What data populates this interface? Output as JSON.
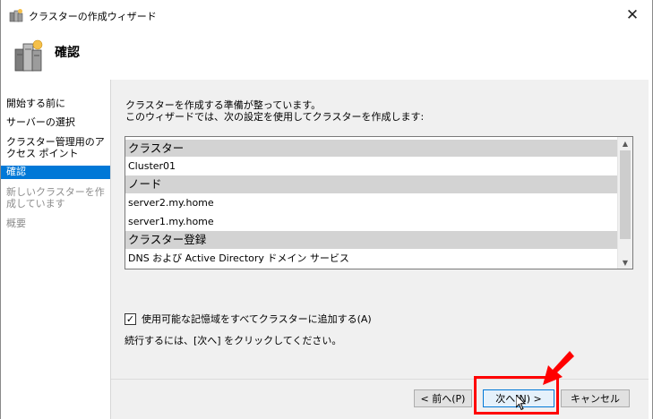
{
  "window": {
    "title": "クラスターの作成ウィザード",
    "close_glyph": "✕"
  },
  "header": {
    "title": "確認"
  },
  "nav": {
    "items": [
      {
        "label": "開始する前に",
        "state": "normal"
      },
      {
        "label": "サーバーの選択",
        "state": "normal"
      },
      {
        "label": "クラスター管理用のアクセス ポイント",
        "state": "normal"
      },
      {
        "label": "確認",
        "state": "active"
      },
      {
        "label": "新しいクラスターを作成しています",
        "state": "disabled"
      },
      {
        "label": "概要",
        "state": "disabled"
      }
    ]
  },
  "main": {
    "intro_line1": "クラスターを作成する準備が整っています。",
    "intro_line2": "このウィザードでは、次の設定を使用してクラスターを作成します:",
    "settings_list": [
      {
        "kind": "header",
        "text": "クラスター"
      },
      {
        "kind": "value",
        "text": "Cluster01"
      },
      {
        "kind": "header",
        "text": "ノード"
      },
      {
        "kind": "value",
        "text": "server2.my.home"
      },
      {
        "kind": "value",
        "text": "server1.my.home"
      },
      {
        "kind": "header",
        "text": "クラスター登録"
      },
      {
        "kind": "value",
        "text": "DNS および Active Directory ドメイン サービス"
      }
    ],
    "scroll_up_glyph": "▲",
    "scroll_down_glyph": "▼",
    "add_storage_label": "使用可能な記憶域をすべてクラスターに追加する(A)",
    "add_storage_checked": true,
    "check_glyph": "✓",
    "continue_note": "続行するには、[次へ] をクリックしてください。"
  },
  "buttons": {
    "back": "< 前へ(P)",
    "next": "次へ(N) >",
    "cancel": "キャンセル"
  },
  "colors": {
    "accent": "#0078d7",
    "highlight": "#ff0000",
    "content_bg": "#f0f0f0",
    "list_header_bg": "#d3d3d3"
  },
  "icons": {
    "title_icon": "cluster-wizard-icon",
    "header_icon": "server-cluster-icon",
    "close_icon": "close-icon",
    "annotation_arrow": "red-arrow-icon",
    "pointer": "mouse-cursor-icon"
  }
}
